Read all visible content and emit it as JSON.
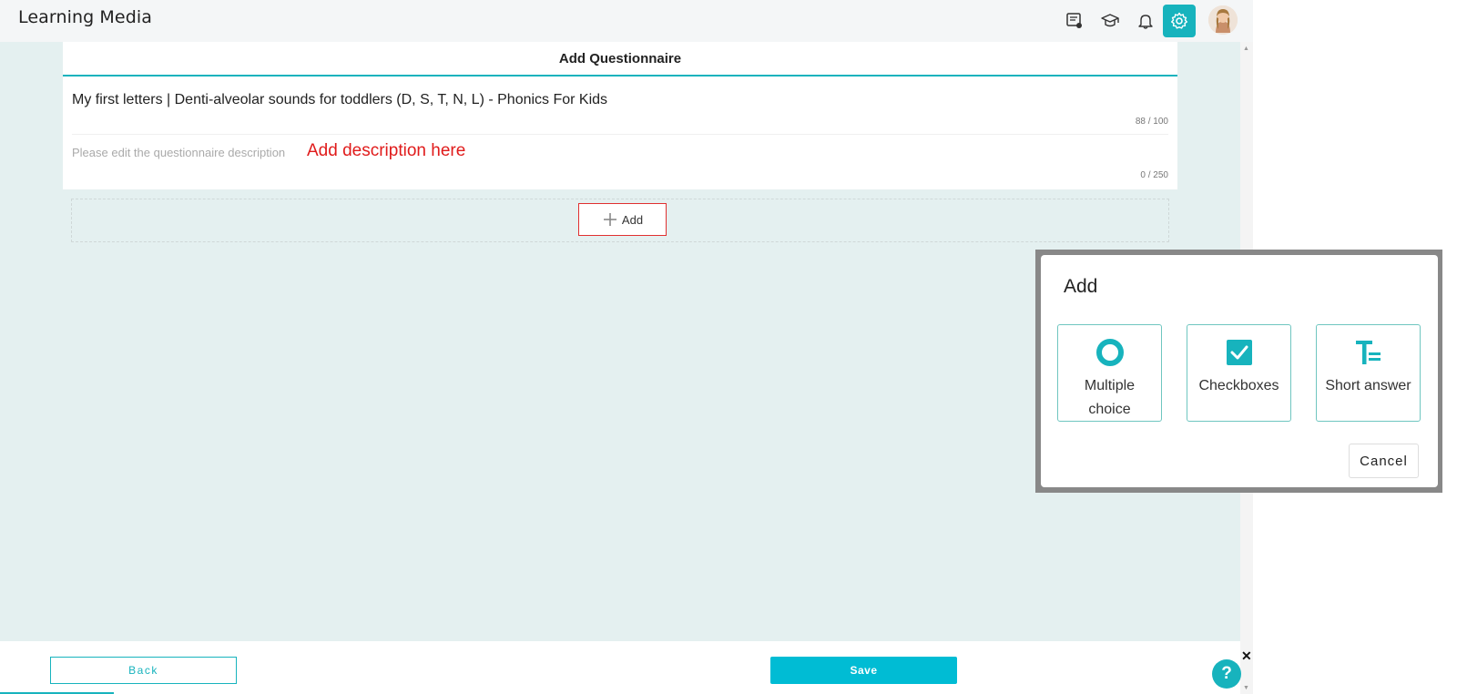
{
  "header": {
    "brand": "Learning Media",
    "icons": [
      "feedback-icon",
      "graduation-cap-icon",
      "bell-icon",
      "gear-icon"
    ]
  },
  "card": {
    "title": "Add Questionnaire",
    "questionnaire_title": "My first letters | Denti-alveolar sounds for toddlers (D, S, T, N, L) - Phonics For Kids",
    "title_counter": "88 / 100",
    "description_placeholder": "Please edit the questionnaire description",
    "description_counter": "0 / 250",
    "annotation": "Add description here"
  },
  "add_zone": {
    "add_label": "Add"
  },
  "footer": {
    "back_label": "Back",
    "save_label": "Save",
    "help_label": "?",
    "close_label": "✕"
  },
  "dialog": {
    "title": "Add",
    "options": [
      {
        "label": "Multiple choice",
        "icon": "radio-icon"
      },
      {
        "label": "Checkboxes",
        "icon": "checkbox-icon"
      },
      {
        "label": "Short answer",
        "icon": "text-icon"
      }
    ],
    "cancel_label": "Cancel"
  },
  "colors": {
    "accent": "#17b3bd",
    "save": "#00bcd4",
    "background": "#e4f0f0",
    "annotation": "#e01b1b"
  }
}
